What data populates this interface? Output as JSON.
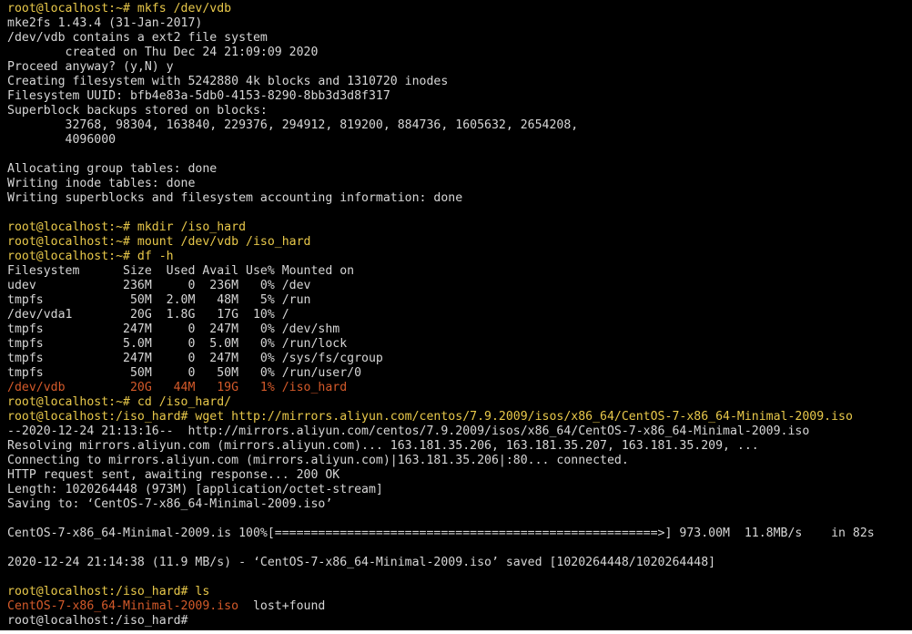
{
  "prompt_user": "root@localhost",
  "colors": {
    "background": "#000000",
    "text": "#d6d6d6",
    "prompt": "#e8c84a",
    "highlight": "#d45a2a"
  },
  "lines": [
    {
      "segs": [
        {
          "t": "root@localhost:~# mkfs /dev/vdb",
          "c": "y"
        }
      ]
    },
    {
      "segs": [
        {
          "t": "mke2fs 1.43.4 (31-Jan-2017)",
          "c": "w"
        }
      ]
    },
    {
      "segs": [
        {
          "t": "/dev/vdb contains a ext2 file system",
          "c": "w"
        }
      ]
    },
    {
      "segs": [
        {
          "t": "        created on Thu Dec 24 21:09:09 2020",
          "c": "w"
        }
      ]
    },
    {
      "segs": [
        {
          "t": "Proceed anyway? (y,N) y",
          "c": "w"
        }
      ]
    },
    {
      "segs": [
        {
          "t": "Creating filesystem with 5242880 4k blocks and 1310720 inodes",
          "c": "w"
        }
      ]
    },
    {
      "segs": [
        {
          "t": "Filesystem UUID: bfb4e83a-5db0-4153-8290-8bb3d3d8f317",
          "c": "w"
        }
      ]
    },
    {
      "segs": [
        {
          "t": "Superblock backups stored on blocks:",
          "c": "w"
        }
      ]
    },
    {
      "segs": [
        {
          "t": "        32768, 98304, 163840, 229376, 294912, 819200, 884736, 1605632, 2654208,",
          "c": "w"
        }
      ]
    },
    {
      "segs": [
        {
          "t": "        4096000",
          "c": "w"
        }
      ]
    },
    {
      "segs": [
        {
          "t": "",
          "c": "w"
        }
      ]
    },
    {
      "segs": [
        {
          "t": "Allocating group tables: done",
          "c": "w"
        }
      ]
    },
    {
      "segs": [
        {
          "t": "Writing inode tables: done",
          "c": "w"
        }
      ]
    },
    {
      "segs": [
        {
          "t": "Writing superblocks and filesystem accounting information: done",
          "c": "w"
        }
      ]
    },
    {
      "segs": [
        {
          "t": "",
          "c": "w"
        }
      ]
    },
    {
      "segs": [
        {
          "t": "root@localhost:~# mkdir /iso_hard",
          "c": "y"
        }
      ]
    },
    {
      "segs": [
        {
          "t": "root@localhost:~# mount /dev/vdb /iso_hard",
          "c": "y"
        }
      ]
    },
    {
      "segs": [
        {
          "t": "root@localhost:~# df -h",
          "c": "y"
        }
      ]
    },
    {
      "segs": [
        {
          "t": "Filesystem      Size  Used Avail Use% Mounted on",
          "c": "w"
        }
      ]
    },
    {
      "segs": [
        {
          "t": "udev            236M     0  236M   0% /dev",
          "c": "w"
        }
      ]
    },
    {
      "segs": [
        {
          "t": "tmpfs            50M  2.0M   48M   5% /run",
          "c": "w"
        }
      ]
    },
    {
      "segs": [
        {
          "t": "/dev/vda1        20G  1.8G   17G  10% /",
          "c": "w"
        }
      ]
    },
    {
      "segs": [
        {
          "t": "tmpfs           247M     0  247M   0% /dev/shm",
          "c": "w"
        }
      ]
    },
    {
      "segs": [
        {
          "t": "tmpfs           5.0M     0  5.0M   0% /run/lock",
          "c": "w"
        }
      ]
    },
    {
      "segs": [
        {
          "t": "tmpfs           247M     0  247M   0% /sys/fs/cgroup",
          "c": "w"
        }
      ]
    },
    {
      "segs": [
        {
          "t": "tmpfs            50M     0   50M   0% /run/user/0",
          "c": "w"
        }
      ]
    },
    {
      "segs": [
        {
          "t": "/dev/vdb         20G   44M   19G   1% /iso_hard",
          "c": "o"
        }
      ]
    },
    {
      "segs": [
        {
          "t": "root@localhost:~# cd /iso_hard/",
          "c": "y"
        }
      ]
    },
    {
      "segs": [
        {
          "t": "root@localhost:/iso_hard# wget http://mirrors.aliyun.com/centos/7.9.2009/isos/x86_64/CentOS-7-x86_64-Minimal-2009.iso",
          "c": "y"
        }
      ]
    },
    {
      "segs": [
        {
          "t": "--2020-12-24 21:13:16--  http://mirrors.aliyun.com/centos/7.9.2009/isos/x86_64/CentOS-7-x86_64-Minimal-2009.iso",
          "c": "w"
        }
      ]
    },
    {
      "segs": [
        {
          "t": "Resolving mirrors.aliyun.com (mirrors.aliyun.com)... 163.181.35.206, 163.181.35.207, 163.181.35.209, ...",
          "c": "w"
        }
      ]
    },
    {
      "segs": [
        {
          "t": "Connecting to mirrors.aliyun.com (mirrors.aliyun.com)|163.181.35.206|:80... connected.",
          "c": "w"
        }
      ]
    },
    {
      "segs": [
        {
          "t": "HTTP request sent, awaiting response... 200 OK",
          "c": "w"
        }
      ]
    },
    {
      "segs": [
        {
          "t": "Length: 1020264448 (973M) [application/octet-stream]",
          "c": "w"
        }
      ]
    },
    {
      "segs": [
        {
          "t": "Saving to: ‘CentOS-7-x86_64-Minimal-2009.iso’",
          "c": "w"
        }
      ]
    },
    {
      "segs": [
        {
          "t": "",
          "c": "w"
        }
      ]
    },
    {
      "segs": [
        {
          "t": "CentOS-7-x86_64-Minimal-2009.is 100%[=====================================================>] 973.00M  11.8MB/s    in 82s",
          "c": "w"
        }
      ]
    },
    {
      "segs": [
        {
          "t": "",
          "c": "w"
        }
      ]
    },
    {
      "segs": [
        {
          "t": "2020-12-24 21:14:38 (11.9 MB/s) - ‘CentOS-7-x86_64-Minimal-2009.iso’ saved [1020264448/1020264448]",
          "c": "w"
        }
      ]
    },
    {
      "segs": [
        {
          "t": "",
          "c": "w"
        }
      ]
    },
    {
      "segs": [
        {
          "t": "root@localhost:/iso_hard# ls",
          "c": "y"
        }
      ]
    },
    {
      "segs": [
        {
          "t": "CentOS-7-x86_64-Minimal-2009.iso",
          "c": "o"
        },
        {
          "t": "  lost+found",
          "c": "w"
        }
      ]
    },
    {
      "segs": [
        {
          "t": "root@localhost:/iso_hard#",
          "c": "w"
        }
      ]
    }
  ]
}
